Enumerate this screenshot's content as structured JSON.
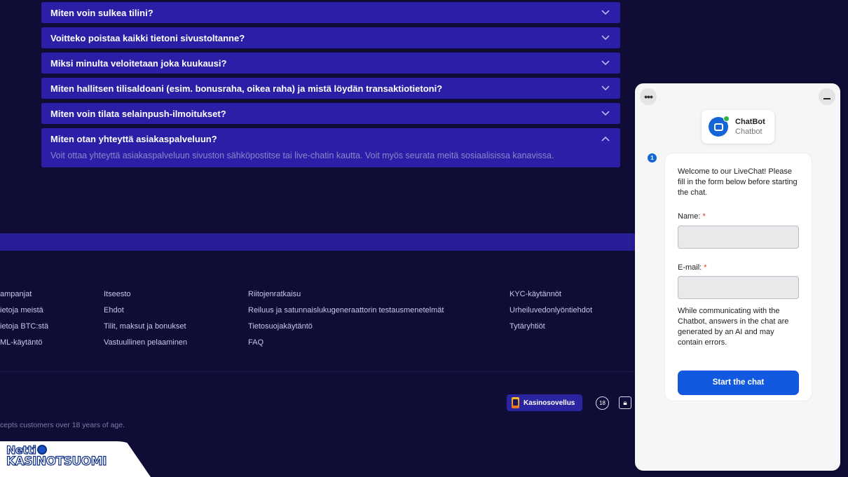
{
  "faq": {
    "items": [
      {
        "question": "Miten voin sulkea tilini?"
      },
      {
        "question": "Voitteko poistaa kaikki tietoni sivustoltanne?"
      },
      {
        "question": "Miksi minulta veloitetaan joka kuukausi?"
      },
      {
        "question": "Miten hallitsen tilisaldoani (esim. bonusraha, oikea raha) ja mistä löydän transaktiotietoni?"
      },
      {
        "question": "Miten voin tilata selainpush-ilmoitukset?"
      }
    ],
    "open_item": {
      "question": "Miten otan yhteyttä asiakaspalveluun?",
      "answer": "Voit ottaa yhteyttä asiakaspalveluun sivuston sähköpostitse tai live-chatin kautta. Voit myös seurata meitä sosiaalisissa kanavissa."
    }
  },
  "footer": {
    "col1": [
      "ampanjat",
      "ietoja meistä",
      "ietoja BTC:stä",
      "ML-käytäntö"
    ],
    "col2": [
      "Itseesto",
      "Ehdot",
      "Tilit, maksut ja bonukset",
      "Vastuullinen pelaaminen"
    ],
    "col3": [
      "Riitojenratkaisu",
      "Reiluus ja satunnaislukugeneraattorin testausmenetelmät",
      "Tietosuojakäytäntö",
      "FAQ"
    ],
    "col4": [
      "KYC-käytännöt",
      "Urheiluvedonlyöntiehdot",
      "Tytäryhtiöt"
    ],
    "app_label": "Kasinosovellus",
    "age_badge": "18",
    "age_text": "cepts customers over 18 years of age."
  },
  "logo": {
    "line1": "Netti",
    "line2a": "KASINOT",
    "line2b": "SUOMI"
  },
  "chat": {
    "menu_label": "•••",
    "agent_name": "ChatBot",
    "agent_role": "Chatbot",
    "unread_count": "1",
    "welcome": "Welcome to our LiveChat! Please fill in the form below before starting the chat.",
    "name_label": "Name:",
    "email_label": "E-mail:",
    "required_mark": "*",
    "note": "While communicating with the Chatbot, answers in the chat are generated by an AI and may contain errors.",
    "start_button": "Start the chat"
  }
}
